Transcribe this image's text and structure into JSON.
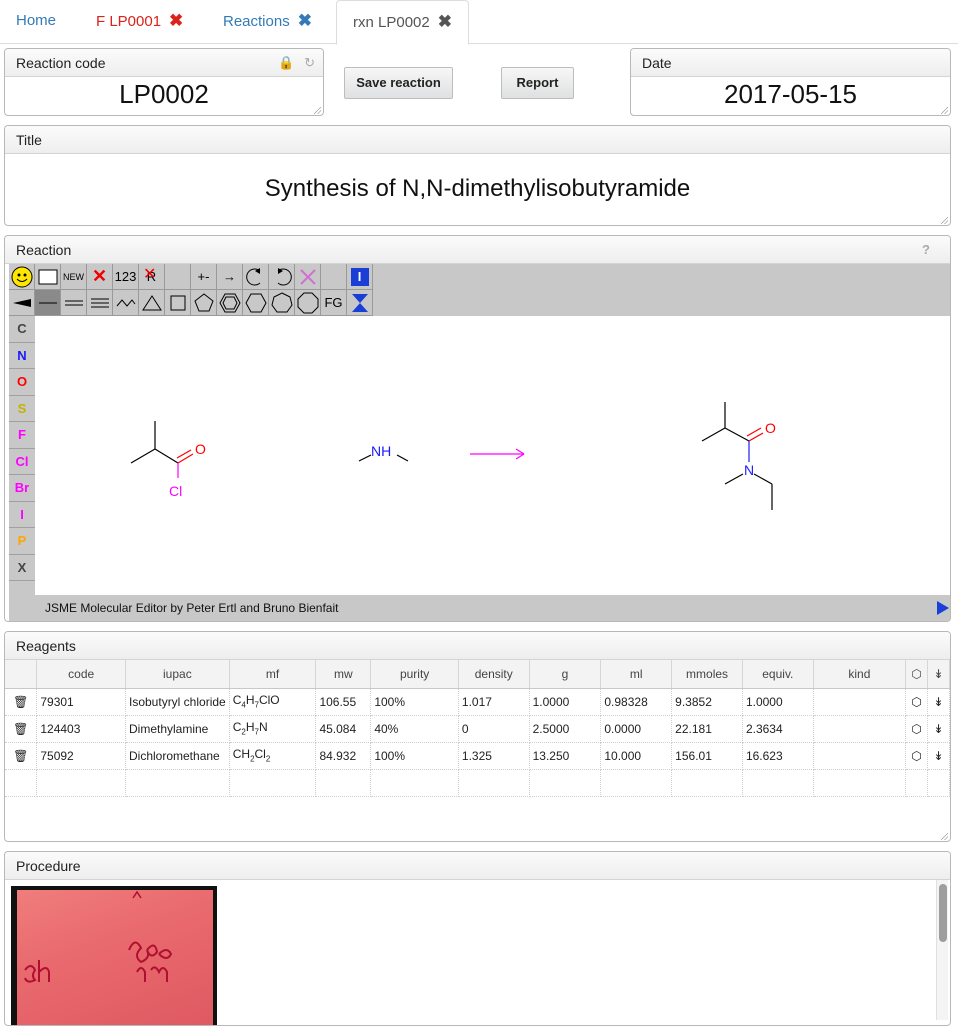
{
  "tabs": [
    {
      "label": "Home",
      "closable": false
    },
    {
      "label": "F LP0001",
      "closable": true
    },
    {
      "label": "Reactions",
      "closable": true
    },
    {
      "label": "rxn LP0002",
      "closable": true
    }
  ],
  "reaction_code": {
    "label": "Reaction code",
    "value": "LP0002"
  },
  "buttons": {
    "save": "Save reaction",
    "report": "Report"
  },
  "date": {
    "label": "Date",
    "value": "2017-05-15"
  },
  "title": {
    "label": "Title",
    "value": "Synthesis of N,N-dimethylisobutyramide"
  },
  "reaction": {
    "label": "Reaction",
    "help": "?",
    "editor_credit": "JSME Molecular Editor by Peter Ertl and Bruno Bienfait",
    "toolbar_text": {
      "new": "NEW",
      "num": "123",
      "rgroup": "R",
      "charge": "+-",
      "arrow": "→",
      "fg": "FG"
    },
    "atoms": [
      "C",
      "N",
      "O",
      "S",
      "F",
      "Cl",
      "Br",
      "I",
      "P",
      "X"
    ],
    "atom_colors": [
      "#444444",
      "#1a1aff",
      "#ff0000",
      "#c2b300",
      "#ff00ff",
      "#ff00ff",
      "#ff00ff",
      "#ff00ff",
      "#ffa500",
      "#444444"
    ],
    "molecule_labels": {
      "o1": "O",
      "cl": "Cl",
      "nh": "NH",
      "o2": "O",
      "n": "N"
    }
  },
  "reagents": {
    "label": "Reagents",
    "columns": [
      "code",
      "iupac",
      "mf",
      "mw",
      "purity",
      "density",
      "g",
      "ml",
      "mmoles",
      "equiv.",
      "kind"
    ],
    "rows": [
      {
        "code": "79301",
        "iupac": "Isobutyryl chloride",
        "mf": "C4H7ClO",
        "mw": "106.55",
        "purity": "100%",
        "density": "1.017",
        "g": "1.0000",
        "ml": "0.98328",
        "mmoles": "9.3852",
        "equiv": "1.0000",
        "kind": ""
      },
      {
        "code": "124403",
        "iupac": "Dimethylamine",
        "mf": "C2H7N",
        "mw": "45.084",
        "purity": "40%",
        "density": "0",
        "g": "2.5000",
        "ml": "0.0000",
        "mmoles": "22.181",
        "equiv": "2.3634",
        "kind": ""
      },
      {
        "code": "75092",
        "iupac": "Dichloromethane",
        "mf": "CH2Cl2",
        "mw": "84.932",
        "purity": "100%",
        "density": "1.325",
        "g": "13.250",
        "ml": "10.000",
        "mmoles": "156.01",
        "equiv": "16.623",
        "kind": ""
      }
    ]
  },
  "procedure": {
    "label": "Procedure"
  }
}
